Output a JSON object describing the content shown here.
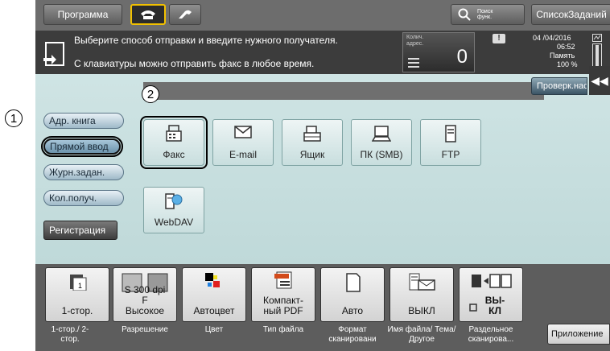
{
  "topbar": {
    "program_label": "Программа",
    "search_label": "Поиск функ.",
    "jobs_label": "СписокЗаданий"
  },
  "message": {
    "line1": "Выберите способ отправки и введите нужного получателя.",
    "line2": "С клавиатуры можно отправить факс в любое время.",
    "dest_count_label": "Колич. адрес.",
    "dest_count_value": "0",
    "date": "04 /04/2016",
    "time": "06:52",
    "memory_label": "Память",
    "memory_value": "100 %",
    "check_label": "Проверк.нас"
  },
  "left_buttons": [
    "Адр. книга",
    "Прямой ввод",
    "Журн.задан.",
    "Кол.получ.",
    "Регистрация"
  ],
  "tiles": [
    "Факс",
    "E-mail",
    "Ящик",
    "ПК (SMB)",
    "FTP",
    "WebDAV"
  ],
  "settings": [
    {
      "value": "1-стор.",
      "label": "1-стор./ 2-стор."
    },
    {
      "value": "S 300 dpi F Высокое",
      "label": "Разрешение"
    },
    {
      "value": "Автоцвет",
      "label": "Цвет"
    },
    {
      "value": "Компакт- ный PDF",
      "label": "Тип файла"
    },
    {
      "value": "Авто",
      "label": "Формат сканировани"
    },
    {
      "value": "ВЫКЛ",
      "label": "Имя файла/ Тема/Другое"
    },
    {
      "value": "ВЫ- КЛ",
      "label": "Раздельное сканирова..."
    }
  ],
  "app_label": "Приложение",
  "callouts": [
    "1",
    "2"
  ],
  "colors": {
    "teal": "#c7dfdf",
    "dark": "#3c3c3c",
    "highlight": "#f2c100"
  }
}
